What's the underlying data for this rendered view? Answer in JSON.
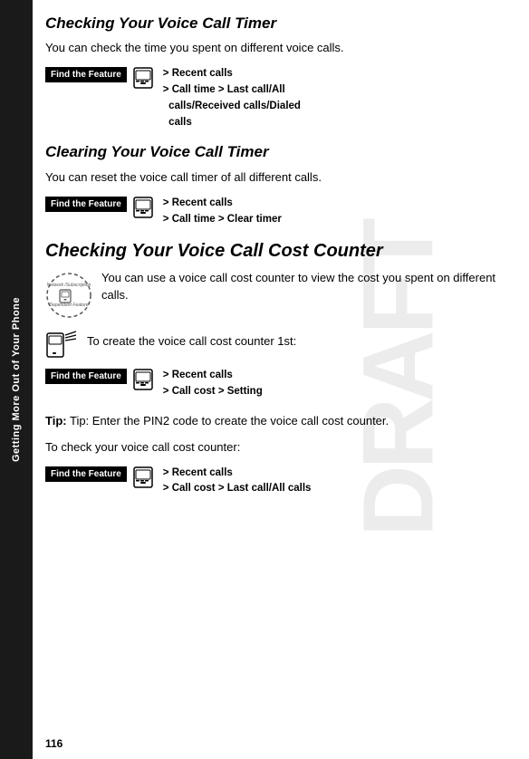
{
  "sidebar": {
    "label": "Getting More Out of Your Phone"
  },
  "page_number": "116",
  "draft_watermark": "DRAFT",
  "sections": [
    {
      "id": "checking-voice-call-timer",
      "heading": "Checking Your Voice Call Timer",
      "body": "You can check the time you spent on different voice calls.",
      "find_feature": {
        "label": "Find the Feature",
        "nav": "> Recent calls\n> Call time > Last call/All calls/Received calls/Dialed calls"
      }
    },
    {
      "id": "clearing-voice-call-timer",
      "heading": "Clearing Your Voice Call Timer",
      "body": "You can reset the voice call timer of all different calls.",
      "find_feature": {
        "label": "Find the Feature",
        "nav": "> Recent calls\n> Call time > Clear timer"
      }
    },
    {
      "id": "checking-voice-call-cost",
      "heading": "Checking Your Voice Call Cost Counter",
      "body": "You can use a voice call cost counter to view the cost you spent on different calls.",
      "sub_instruction": "To create the voice call cost counter 1st:",
      "find_feature_1": {
        "label": "Find the Feature",
        "nav": "> Recent calls\n> Call cost > Setting"
      },
      "tip": "Tip: Enter the PIN2 code to create the voice call cost counter.",
      "sub_instruction_2": "To check your voice call cost counter:",
      "find_feature_2": {
        "label": "Find the Feature",
        "nav": "> Recent calls\n> Call cost > Last call/All calls"
      }
    }
  ]
}
